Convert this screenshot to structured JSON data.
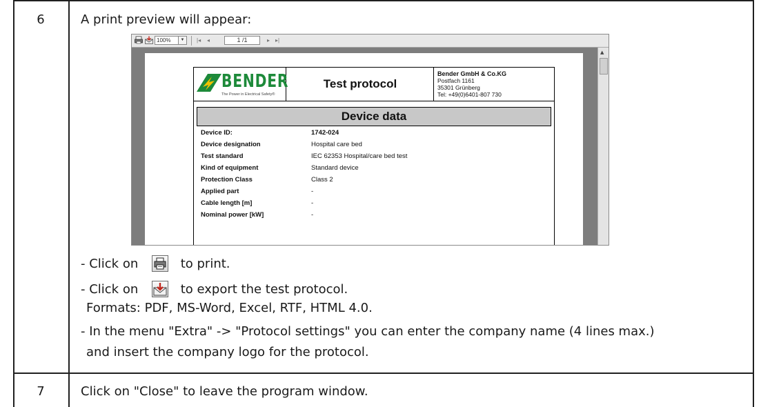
{
  "steps": [
    {
      "number": "6",
      "heading": "A print preview will appear:",
      "lines": [
        "- Click on",
        "to print.",
        "- Click on",
        "to export the test protocol.",
        "Formats: PDF, MS-Word, Excel, RTF, HTML 4.0.",
        "- In the menu \"Extra\" -> \"Protocol settings\" you can enter the company name (4 lines max.)",
        "and insert the company logo for the protocol."
      ]
    },
    {
      "number": "7",
      "heading": "Click on \"Close\" to leave the program window."
    }
  ],
  "preview": {
    "toolbar": {
      "zoom": "100%",
      "page_display": "1 /1"
    },
    "header": {
      "logo_text": "BENDER",
      "logo_tagline": "The Power in Electrical Safety®",
      "title": "Test protocol",
      "address": [
        "Bender GmbH & Co.KG",
        "Postfach 1161",
        "35301 Grünberg",
        "Tel: +49(0)6401-807 730"
      ]
    },
    "section_title": "Device data",
    "rows": [
      {
        "label": "Device ID:",
        "value": "1742-024"
      },
      {
        "label": "Device designation",
        "value": "Hospital care bed"
      },
      {
        "label": "Test standard",
        "value": "IEC 62353 Hospital/care bed test"
      },
      {
        "label": "Kind of equipment",
        "value": "Standard device"
      },
      {
        "label": "Protection Class",
        "value": "Class 2"
      },
      {
        "label": "Applied part",
        "value": "-"
      },
      {
        "label": "Cable length  [m]",
        "value": "-"
      },
      {
        "label": "Nominal power  [kW]",
        "value": "-"
      }
    ]
  },
  "icons": {
    "print": "printer-icon",
    "export": "export-envelope-icon"
  },
  "colors": {
    "logo_green": "#1d8a3a",
    "logo_yellow": "#f2c200",
    "section_bar": "#c8c8c8",
    "preview_bg": "#7d7d7d"
  }
}
